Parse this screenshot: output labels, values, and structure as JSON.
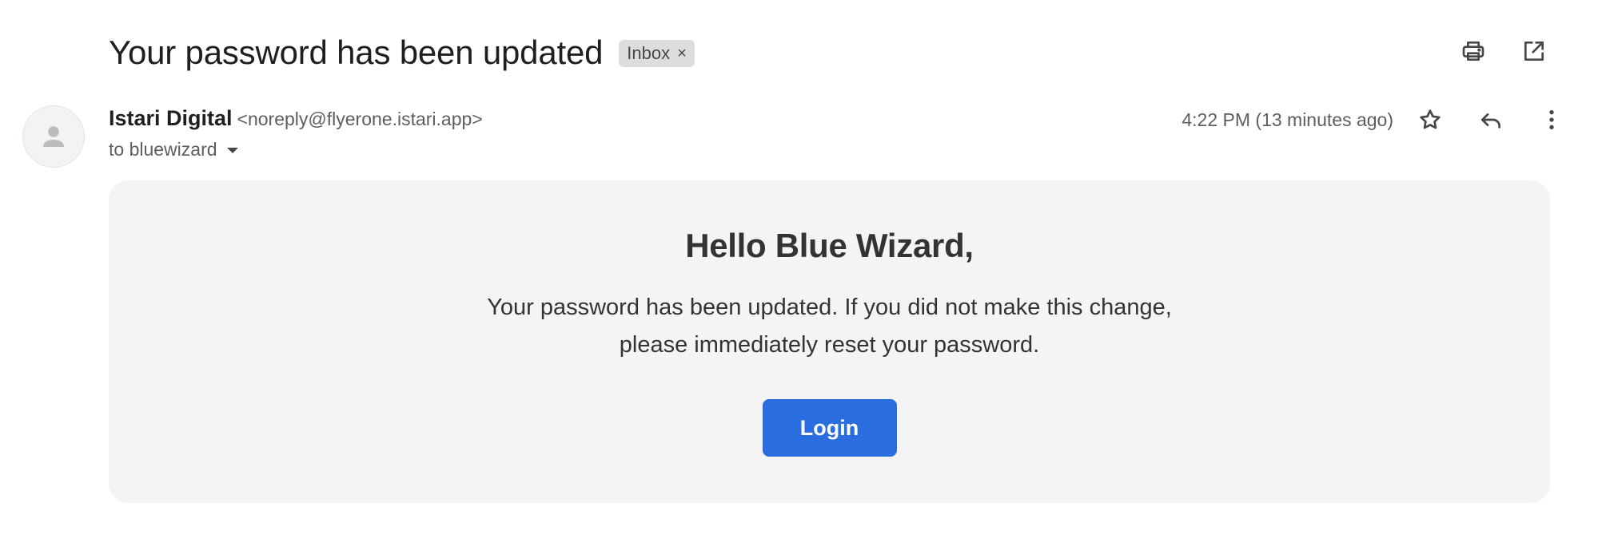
{
  "subject": {
    "title": "Your password has been updated",
    "label": "Inbox",
    "label_remove": "×"
  },
  "toolbar": {
    "print_icon": "print-icon",
    "open_new_window_icon": "open-in-new-icon"
  },
  "sender": {
    "name": "Istari Digital",
    "email": "<noreply@flyerone.istari.app>",
    "to": "to bluewizard",
    "avatar_icon": "person-icon"
  },
  "meta": {
    "timestamp": "4:22 PM (13 minutes ago)",
    "star_icon": "star-icon",
    "reply_icon": "reply-icon",
    "more_icon": "more-vert-icon"
  },
  "message": {
    "greeting": "Hello Blue Wizard,",
    "body": "Your password has been updated. If you did not make this change, please immediately reset your password.",
    "button_label": "Login"
  },
  "colors": {
    "button": "#2a6de0",
    "card_background": "#f4f4f4",
    "label_chip": "#dddddd"
  }
}
